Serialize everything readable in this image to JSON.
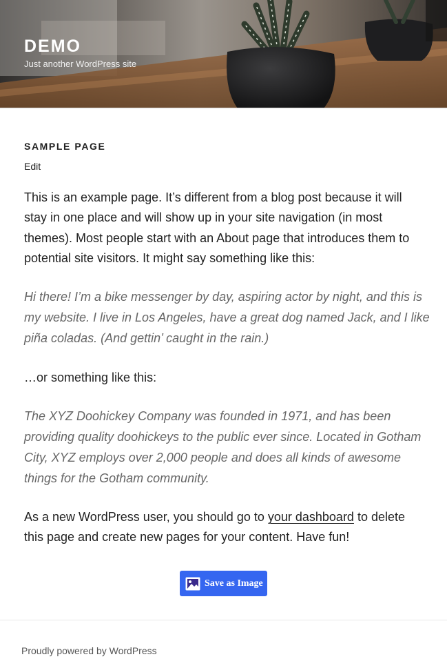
{
  "header": {
    "site_title": "DEMO",
    "tagline": "Just another WordPress site"
  },
  "page": {
    "title": "SAMPLE PAGE",
    "edit_label": "Edit",
    "para1": "This is an example page. It’s different from a blog post because it will stay in one place and will show up in your site navigation (in most themes). Most people start with an About page that introduces them to potential site visitors. It might say something like this:",
    "quote1": "Hi there! I’m a bike messenger by day, aspiring actor by night, and this is my website. I live in Los Angeles, have a great dog named Jack, and I like piña coladas. (And gettin’ caught in the rain.)",
    "para2": "…or something like this:",
    "quote2": "The XYZ Doohickey Company was founded in 1971, and has been providing quality doohickeys to the public ever since. Located in Gotham City, XYZ employs over 2,000 people and does all kinds of awesome things for the Gotham community.",
    "para3_before": "As a new WordPress user, you should go to ",
    "para3_link": "your dashboard",
    "para3_after": " to delete this page and create new pages for your content. Have fun!"
  },
  "save_button": {
    "label": "Save as Image",
    "icon": "image-icon",
    "color": "#3566f0"
  },
  "footer": {
    "text": "Proudly powered by WordPress"
  }
}
